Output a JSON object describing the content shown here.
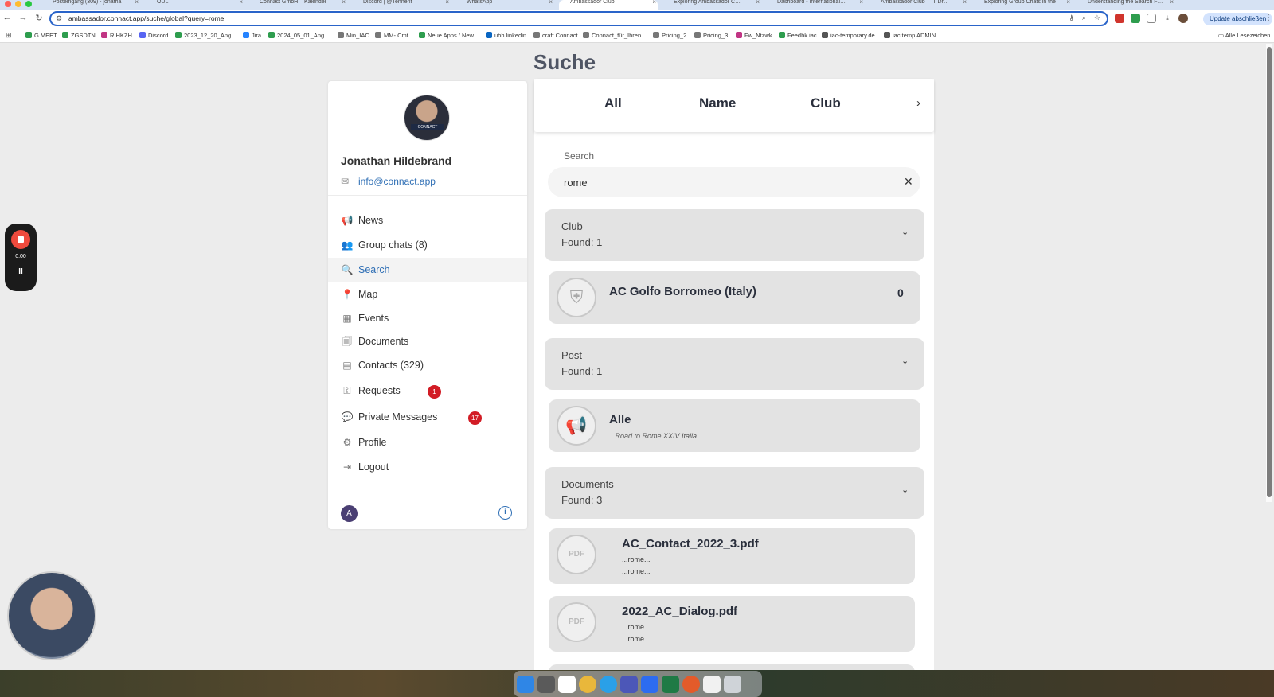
{
  "browser": {
    "tabs": [
      {
        "label": "Posteingang (309) - jonatha",
        "active": false
      },
      {
        "label": "OUL",
        "active": false
      },
      {
        "label": "Connact GmbH – Kalender",
        "active": false
      },
      {
        "label": "Discord | @Tennent",
        "active": false
      },
      {
        "label": "WhatsApp",
        "active": false
      },
      {
        "label": "Ambassador Club",
        "active": true
      },
      {
        "label": "Exploring Ambassador C…",
        "active": false
      },
      {
        "label": "Dashboard - International…",
        "active": false
      },
      {
        "label": "Ambassador Club – IT Dr…",
        "active": false
      },
      {
        "label": "Exploring Group Chats in the",
        "active": false
      },
      {
        "label": "Understanding the Search F…",
        "active": false
      }
    ],
    "url": "ambassador.connact.app/suche/global?query=rome",
    "update_label": "Update abschließen",
    "bookmarks": [
      "G MEET",
      "ZGSDTN",
      "R HKZH",
      "Discord",
      "2023_12_20_Ang…",
      "Jira",
      "2024_05_01_Ang…",
      "Min_IAC",
      "MM- Cmt",
      "Neue Apps / New…",
      "uhh linkedin",
      "craft Connact",
      "Connact_für_Ihren…",
      "Pricing_2",
      "Pricing_3",
      "Fw_Ntzwk",
      "Feedbk iac",
      "iac-temporary.de",
      "iac temp ADMIN"
    ],
    "bookmarks_right": "Alle Lesezeichen"
  },
  "page": {
    "title": "Suche"
  },
  "sidebar": {
    "user_name": "Jonathan Hildebrand",
    "email": "info@connact.app",
    "avatar_logo_text": "CONNACT",
    "footer_avatar_letter": "A",
    "items": [
      {
        "key": "news",
        "label": "News",
        "icon": "megaphone-icon",
        "glyph": "📢",
        "badge": ""
      },
      {
        "key": "group-chats",
        "label": "Group chats (8)",
        "icon": "group-chat-icon",
        "glyph": "👥",
        "badge": ""
      },
      {
        "key": "search",
        "label": "Search",
        "icon": "search-icon",
        "glyph": "🔍",
        "badge": "",
        "active": true
      },
      {
        "key": "map",
        "label": "Map",
        "icon": "map-pin-icon",
        "glyph": "📍",
        "badge": ""
      },
      {
        "key": "events",
        "label": "Events",
        "icon": "calendar-icon",
        "glyph": "▦",
        "badge": ""
      },
      {
        "key": "documents",
        "label": "Documents",
        "icon": "documents-icon",
        "glyph": "🗐",
        "badge": ""
      },
      {
        "key": "contacts",
        "label": "Contacts (329)",
        "icon": "contacts-icon",
        "glyph": "▤",
        "badge": ""
      },
      {
        "key": "requests",
        "label": "Requests",
        "icon": "requests-icon",
        "glyph": "⚿",
        "badge": "1"
      },
      {
        "key": "private-messages",
        "label": "Private Messages",
        "icon": "message-icon",
        "glyph": "💬",
        "badge": "17"
      },
      {
        "key": "profile",
        "label": "Profile",
        "icon": "gear-icon",
        "glyph": "⚙",
        "badge": ""
      },
      {
        "key": "logout",
        "label": "Logout",
        "icon": "logout-icon",
        "glyph": "⇥",
        "badge": ""
      }
    ]
  },
  "filters": {
    "tabs": [
      "All",
      "Name",
      "Club"
    ]
  },
  "search": {
    "label": "Search",
    "value": "rome"
  },
  "groups": {
    "club": {
      "title": "Club",
      "found": "Found: 1"
    },
    "post": {
      "title": "Post",
      "found": "Found: 1"
    },
    "documents": {
      "title": "Documents",
      "found": "Found: 3"
    }
  },
  "results": {
    "club": {
      "title": "AC Golfo Borromeo (Italy)",
      "count": "0"
    },
    "post": {
      "title": "Alle",
      "snippet": "...Road to Rome XXIV Italia..."
    },
    "docs": [
      {
        "title": "AC_Contact_2022_3.pdf",
        "line1": "...rome...",
        "line2": "...rome...",
        "icon_text": "PDF"
      },
      {
        "title": "2022_AC_Dialog.pdf",
        "line1": "...rome...",
        "line2": "...rome...",
        "icon_text": "PDF"
      }
    ]
  },
  "recorder": {
    "time": "0:00",
    "pause_glyph": "II"
  },
  "colors": {
    "accent": "#2f6fb5",
    "badge": "#d21c25",
    "record": "#ef4a3d"
  }
}
